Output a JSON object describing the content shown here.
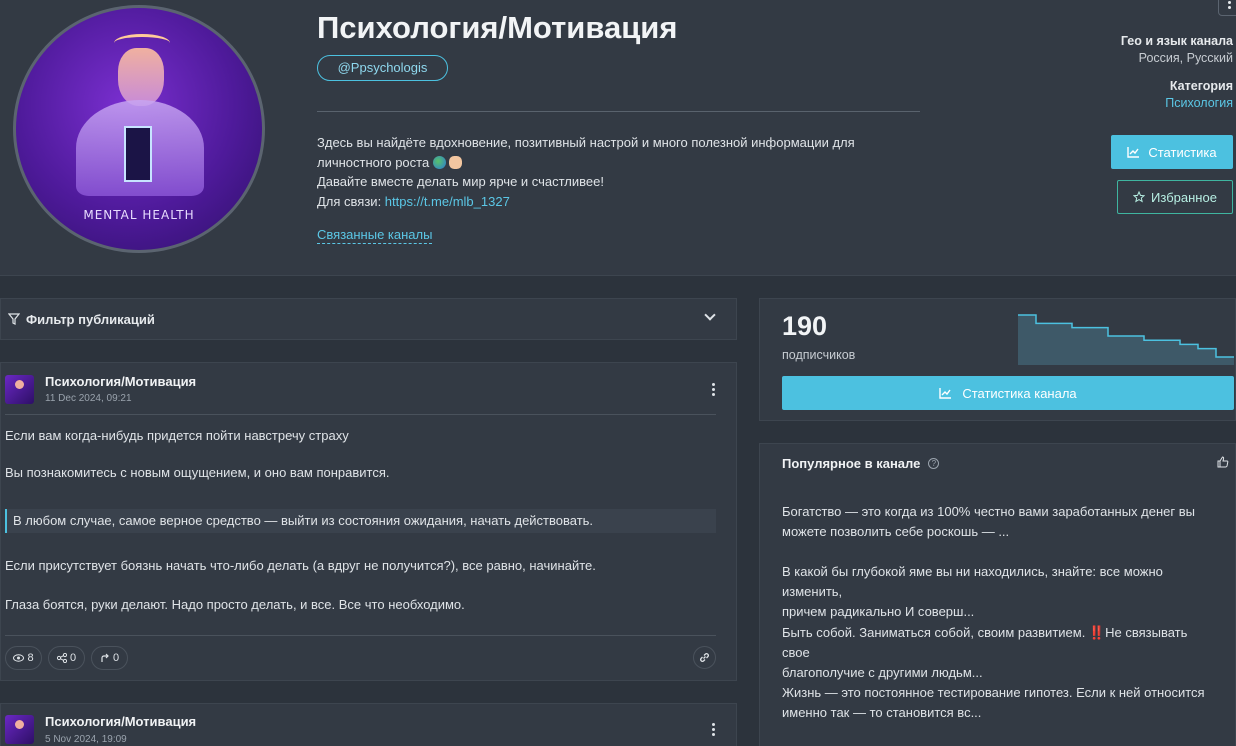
{
  "channel": {
    "title": "Психология/Мотивация",
    "handle": "@Ppsychologis",
    "avatar_caption": "MENTAL HEALTH",
    "description": {
      "line1": "Здесь вы найдёте вдохновение, позитивный настрой и много полезной информации для",
      "line2": "личностного роста",
      "line3": "Давайте вместе делать мир ярче и счастливее!",
      "contact_label": "Для связи: ",
      "contact_link": "https://t.me/mlb_1327"
    },
    "related_link": "Связанные каналы",
    "geo_label": "Гео и язык канала",
    "geo_value": "Россия, Русский",
    "category_label": "Категория",
    "category_value": "Психология",
    "stats_button": "Статистика",
    "favorite_button": "Избранное"
  },
  "filter": {
    "label": "Фильтр публикаций"
  },
  "posts": [
    {
      "author": "Психология/Мотивация",
      "date": "11 Dec 2024, 09:21",
      "p1": "Если вам когда-нибудь придется пойти навстречу страху",
      "p2": "Вы познакомитесь с новым ощущением, и оно вам понравится.",
      "quote": "В любом случае, самое верное средство — выйти из состояния ожидания, начать действовать.",
      "p3": "Если присутствует боязнь начать что-либо делать (а вдруг не получится?), все равно, начинайте.",
      "p4": "Глаза боятся, руки делают. Надо просто делать, и все. Все что необходимо.",
      "views": "8",
      "shares": "0",
      "forwards": "0"
    },
    {
      "author": "Психология/Мотивация",
      "date": "5 Nov 2024, 19:09"
    }
  ],
  "subscribers": {
    "count": "190",
    "label": "подписчиков",
    "button": "Статистика канала",
    "trend": [
      200,
      198,
      198,
      197,
      197,
      195,
      195,
      194,
      194,
      193,
      192,
      190,
      190
    ]
  },
  "popular": {
    "title": "Популярное в канале",
    "items": [
      {
        "l1": "Богатство — это когда из 100% честно вами заработанных денег вы",
        "l2": "можете позволить себе роскошь — ..."
      },
      {
        "l1": "В какой бы глубокой яме вы ни находились, знайте: все можно изменить,",
        "l2": "причем радикально И соверш..."
      },
      {
        "l1": "Быть собой. Заниматься собой, своим развитием. ‼️Не связывать свое",
        "l2": "благополучие с другими людьм..."
      },
      {
        "l1": "Жизнь — это постоянное тестирование гипотез. Если к ней относится",
        "l2": "именно так — то становится вс..."
      }
    ]
  },
  "colors": {
    "accent": "#4cc1e0",
    "background": "#2c333c",
    "card": "#333a44",
    "favorite_border": "#3fb5a0"
  }
}
